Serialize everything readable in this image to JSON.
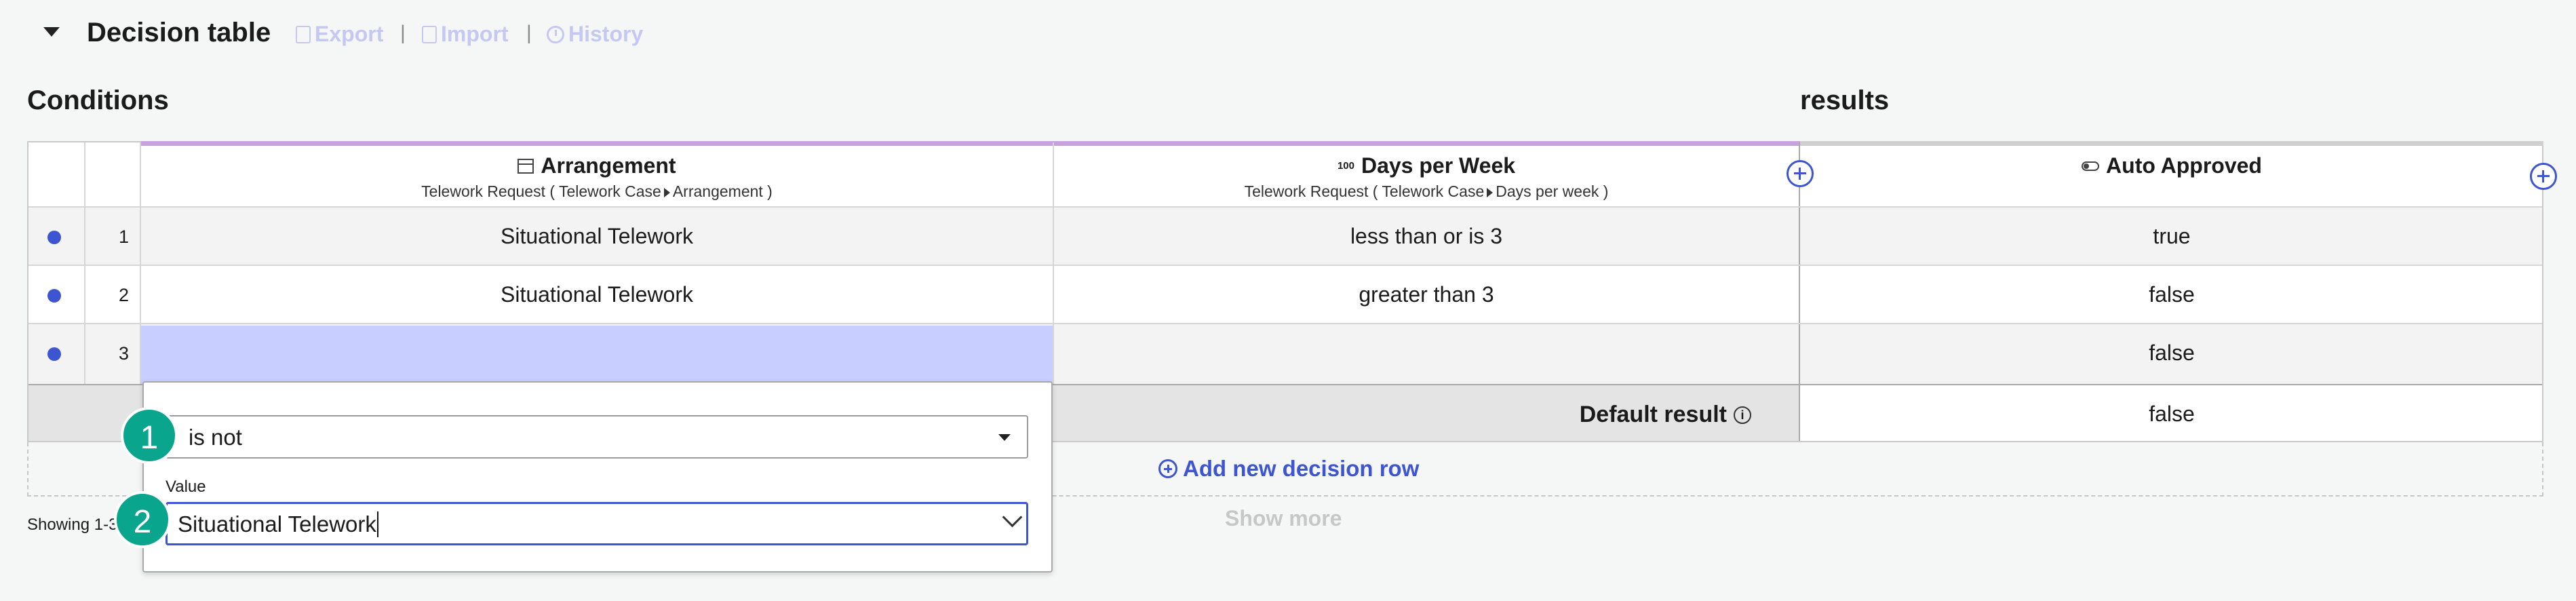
{
  "header": {
    "title": "Decision table",
    "export_label": "Export",
    "import_label": "Import",
    "history_label": "History",
    "separator": "|"
  },
  "sections": {
    "conditions": "Conditions",
    "results": "results"
  },
  "columns": [
    {
      "name": "Arrangement",
      "icon": "table-icon",
      "source": "Telework Request ( Telework Case",
      "field": "Arrangement )"
    },
    {
      "name": "Days per Week",
      "icon": "number-icon",
      "icon_text": "100",
      "source": "Telework Request ( Telework Case",
      "field": "Days per week )"
    },
    {
      "name": "Auto Approved",
      "icon": "toggle-icon"
    }
  ],
  "rows": [
    {
      "num": "1",
      "arrangement": "Situational Telework",
      "days": "less than or is 3",
      "result": "true"
    },
    {
      "num": "2",
      "arrangement": "Situational Telework",
      "days": "greater than 3",
      "result": "false"
    },
    {
      "num": "3",
      "arrangement": "",
      "days": "",
      "result": "false"
    }
  ],
  "default_result": {
    "label": "Default result",
    "value": "false"
  },
  "add_row_label": "Add new decision row",
  "showing_text": "Showing 1-3",
  "show_more_label": "Show more",
  "popover": {
    "operator": "is not",
    "value_label": "Value",
    "value": "Situational Telework"
  },
  "badges": [
    "1",
    "2"
  ],
  "colors": {
    "accent": "#3d55d0",
    "selected_cell": "#c8ceff",
    "badge": "#0aa58d",
    "condition_strip": "#c6a2dc"
  }
}
